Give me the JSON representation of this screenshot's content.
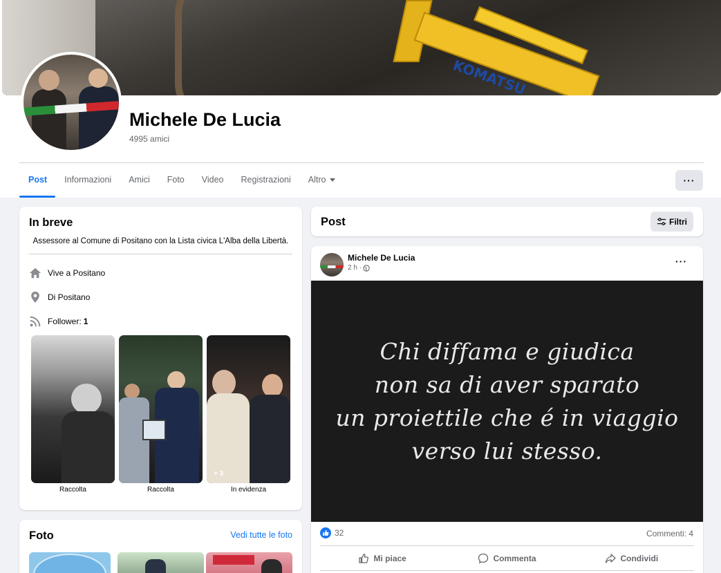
{
  "profile": {
    "name": "Michele De Lucia",
    "friends": "4995 amici"
  },
  "tabs": [
    {
      "label": "Post",
      "active": true
    },
    {
      "label": "Informazioni"
    },
    {
      "label": "Amici"
    },
    {
      "label": "Foto"
    },
    {
      "label": "Video"
    },
    {
      "label": "Registrazioni"
    },
    {
      "label": "Altro"
    }
  ],
  "more_button": "···",
  "intro": {
    "title": "In breve",
    "bio": "Assessore al Comune di Positano con la Lista civica L'Alba della Libertà.",
    "lives": "Vive a Positano",
    "from": "Di Positano",
    "followers_label": "Follower:",
    "followers_value": "1",
    "featured": [
      {
        "label": "Raccolta"
      },
      {
        "label": "Raccolta"
      },
      {
        "label": "In evidenza",
        "extra": "+ 3"
      }
    ]
  },
  "photos": {
    "title": "Foto",
    "see_all": "Vedi tutte le foto"
  },
  "posts_header": {
    "title": "Post",
    "filter": "Filtri"
  },
  "post": {
    "author": "Michele De Lucia",
    "time": "2 h ·",
    "quote": "Chi diffama e giudica\nnon sa di aver sparato\nun proiettile che é in viaggio\nverso lui stesso.",
    "likes": "32",
    "comments": "Commenti: 4",
    "actions": {
      "like": "Mi piace",
      "comment": "Commenta",
      "share": "Condividi"
    }
  },
  "colors": {
    "accent": "#1877f2",
    "background": "#f0f2f5",
    "secondary_text": "#65676b"
  }
}
